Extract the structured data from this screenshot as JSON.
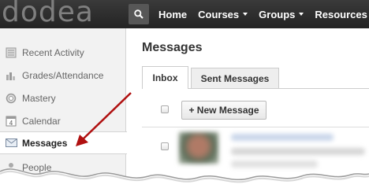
{
  "header": {
    "logo_text": "dodea",
    "nav": [
      {
        "label": "Home",
        "has_dropdown": false
      },
      {
        "label": "Courses",
        "has_dropdown": true
      },
      {
        "label": "Groups",
        "has_dropdown": true
      },
      {
        "label": "Resources",
        "has_dropdown": true
      }
    ]
  },
  "sidebar": {
    "items": [
      {
        "label": "Recent Activity",
        "icon": "list-icon"
      },
      {
        "label": "Grades/Attendance",
        "icon": "chart-icon"
      },
      {
        "label": "Mastery",
        "icon": "badge-icon"
      },
      {
        "label": "Calendar",
        "icon": "calendar-icon",
        "icon_text": "4"
      },
      {
        "label": "Messages",
        "icon": "envelope-icon",
        "active": true
      },
      {
        "label": "People",
        "icon": "person-icon"
      }
    ]
  },
  "main": {
    "title": "Messages",
    "tabs": [
      {
        "label": "Inbox",
        "active": true
      },
      {
        "label": "Sent Messages",
        "active": false
      }
    ],
    "new_message_label": "+ New Message"
  },
  "colors": {
    "topbar": "#2c2c2c",
    "arrow": "#b01010",
    "sidebar_bg": "#f2f2f2"
  }
}
